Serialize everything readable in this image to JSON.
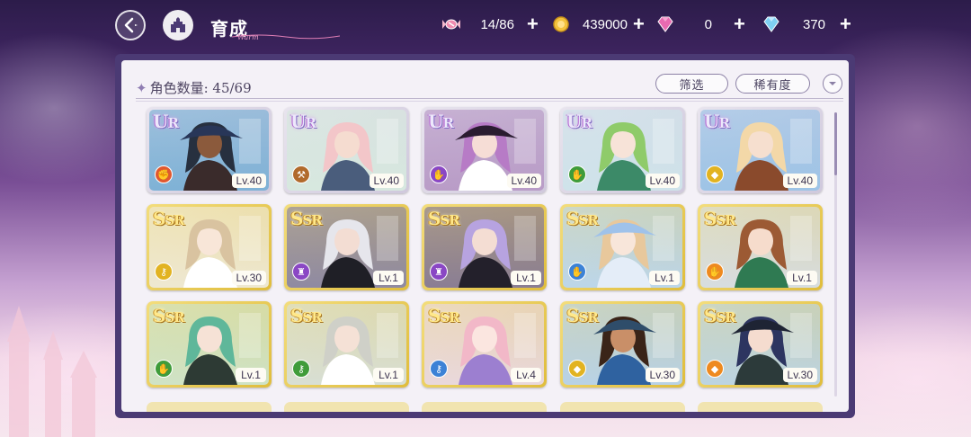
{
  "header": {
    "title": "育成",
    "title_deco": "Warm"
  },
  "resources": [
    {
      "name": "candy",
      "icon": "candy-icon",
      "value": "14/86"
    },
    {
      "name": "coin",
      "icon": "coin-icon",
      "value": "439000"
    },
    {
      "name": "pink-gem",
      "icon": "pink-gem-icon",
      "value": "0"
    },
    {
      "name": "blue-diamond",
      "icon": "diamond-icon",
      "value": "370"
    }
  ],
  "panel": {
    "count_label": "角色数量: 45/69",
    "filter_label": "筛选",
    "sort_label": "稀有度"
  },
  "colors": {
    "element_red": "#e0582f",
    "element_brown": "#b16a2c",
    "element_purple": "#8a47c4",
    "element_green": "#3f9c3a",
    "element_yellow": "#e2b321",
    "element_blue": "#3c82d6",
    "element_orange": "#ee8a1f",
    "ur_text": "#ede8fb",
    "ssr_text": "#ffe88a"
  },
  "cards": [
    {
      "rarity_main": "U",
      "rarity_rest": "R",
      "rarity": "ur",
      "level": "Lv.40",
      "element": "red",
      "element_icon": "fist-icon",
      "art": {
        "bg": "#7fb2d6",
        "hair": "#27303f",
        "skin": "#8b5a3c",
        "hat": "#283658",
        "cloth": "#3a2b2b"
      }
    },
    {
      "rarity_main": "U",
      "rarity_rest": "R",
      "rarity": "ur",
      "level": "Lv.40",
      "element": "brown",
      "element_icon": "hammer-icon",
      "art": {
        "bg": "#d7e8df",
        "hair": "#f3c6c9",
        "skin": "#f5dcd0",
        "hat": "",
        "cloth": "#4a5d7c"
      }
    },
    {
      "rarity_main": "U",
      "rarity_rest": "R",
      "rarity": "ur",
      "level": "Lv.40",
      "element": "purple",
      "element_icon": "hand-icon",
      "art": {
        "bg": "#b99cc7",
        "hair": "#b77bc6",
        "skin": "#f6ddd6",
        "hat": "#2a1c30",
        "cloth": "#ffffff"
      }
    },
    {
      "rarity_main": "U",
      "rarity_rest": "R",
      "rarity": "ur",
      "level": "Lv.40",
      "element": "green",
      "element_icon": "hand-icon",
      "art": {
        "bg": "#cfe3ea",
        "hair": "#8fcb6a",
        "skin": "#f7e3d8",
        "hat": "",
        "cloth": "#3c8a68"
      }
    },
    {
      "rarity_main": "U",
      "rarity_rest": "R",
      "rarity": "ur",
      "level": "Lv.40",
      "element": "yellow",
      "element_icon": "bag-icon",
      "art": {
        "bg": "#9ec4e6",
        "hair": "#f3d8a8",
        "skin": "#f6dfcf",
        "hat": "",
        "cloth": "#8a4a2c"
      }
    },
    {
      "rarity_main": "S",
      "rarity_rest": "SR",
      "rarity": "ssr",
      "level": "Lv.30",
      "element": "yellow",
      "element_icon": "key-icon",
      "art": {
        "bg": "#eee8d2",
        "hair": "#d9c3a0",
        "skin": "#f8e6d8",
        "hat": "",
        "cloth": "#ffffff"
      }
    },
    {
      "rarity_main": "S",
      "rarity_rest": "SR",
      "rarity": "ssr",
      "level": "Lv.1",
      "element": "purple",
      "element_icon": "hat-icon",
      "art": {
        "bg": "#8f8aa2",
        "hair": "#e6e6ec",
        "skin": "#f3ddd3",
        "hat": "",
        "cloth": "#1f1f26"
      }
    },
    {
      "rarity_main": "S",
      "rarity_rest": "SR",
      "rarity": "ssr",
      "level": "Lv.1",
      "element": "purple",
      "element_icon": "hat-icon",
      "art": {
        "bg": "#8a7e94",
        "hair": "#b7a3e0",
        "skin": "#f4ddd3",
        "hat": "",
        "cloth": "#23202b"
      }
    },
    {
      "rarity_main": "S",
      "rarity_rest": "SR",
      "rarity": "ssr",
      "level": "Lv.1",
      "element": "blue",
      "element_icon": "hand-icon",
      "art": {
        "bg": "#bcd6ea",
        "hair": "#e8c89c",
        "skin": "#f8e6da",
        "hat": "#9fc2ea",
        "cloth": "#e4edf8"
      }
    },
    {
      "rarity_main": "S",
      "rarity_rest": "SR",
      "rarity": "ssr",
      "level": "Lv.1",
      "element": "orange",
      "element_icon": "hand-icon",
      "art": {
        "bg": "#d7dde0",
        "hair": "#9c5a34",
        "skin": "#f6dccc",
        "hat": "",
        "cloth": "#2f7a52"
      }
    },
    {
      "rarity_main": "S",
      "rarity_rest": "SR",
      "rarity": "ssr",
      "level": "Lv.1",
      "element": "green",
      "element_icon": "hand-icon",
      "art": {
        "bg": "#cfe3c6",
        "hair": "#5fb79a",
        "skin": "#f6e2d6",
        "hat": "",
        "cloth": "#2d3a34"
      }
    },
    {
      "rarity_main": "S",
      "rarity_rest": "SR",
      "rarity": "ssr",
      "level": "Lv.1",
      "element": "green",
      "element_icon": "key-icon",
      "art": {
        "bg": "#d8dfd4",
        "hair": "#cfd0c8",
        "skin": "#f5e1d6",
        "hat": "",
        "cloth": "#ffffff"
      }
    },
    {
      "rarity_main": "S",
      "rarity_rest": "SR",
      "rarity": "ssr",
      "level": "Lv.4",
      "element": "blue",
      "element_icon": "key-icon",
      "art": {
        "bg": "#e9d8dc",
        "hair": "#f2b8c8",
        "skin": "#fbe6e0",
        "hat": "",
        "cloth": "#9c7fd0"
      }
    },
    {
      "rarity_main": "S",
      "rarity_rest": "SR",
      "rarity": "ssr",
      "level": "Lv.30",
      "element": "yellow",
      "element_icon": "bag-icon",
      "art": {
        "bg": "#b8d2e6",
        "hair": "#3a2418",
        "skin": "#c98f68",
        "hat": "#2f4d6a",
        "cloth": "#2f62a0"
      }
    },
    {
      "rarity_main": "S",
      "rarity_rest": "SR",
      "rarity": "ssr",
      "level": "Lv.30",
      "element": "orange",
      "element_icon": "bag-icon",
      "art": {
        "bg": "#bcd4e2",
        "hair": "#2d3560",
        "skin": "#f5dccf",
        "hat": "#1e2434",
        "cloth": "#2c3a3a"
      }
    }
  ]
}
